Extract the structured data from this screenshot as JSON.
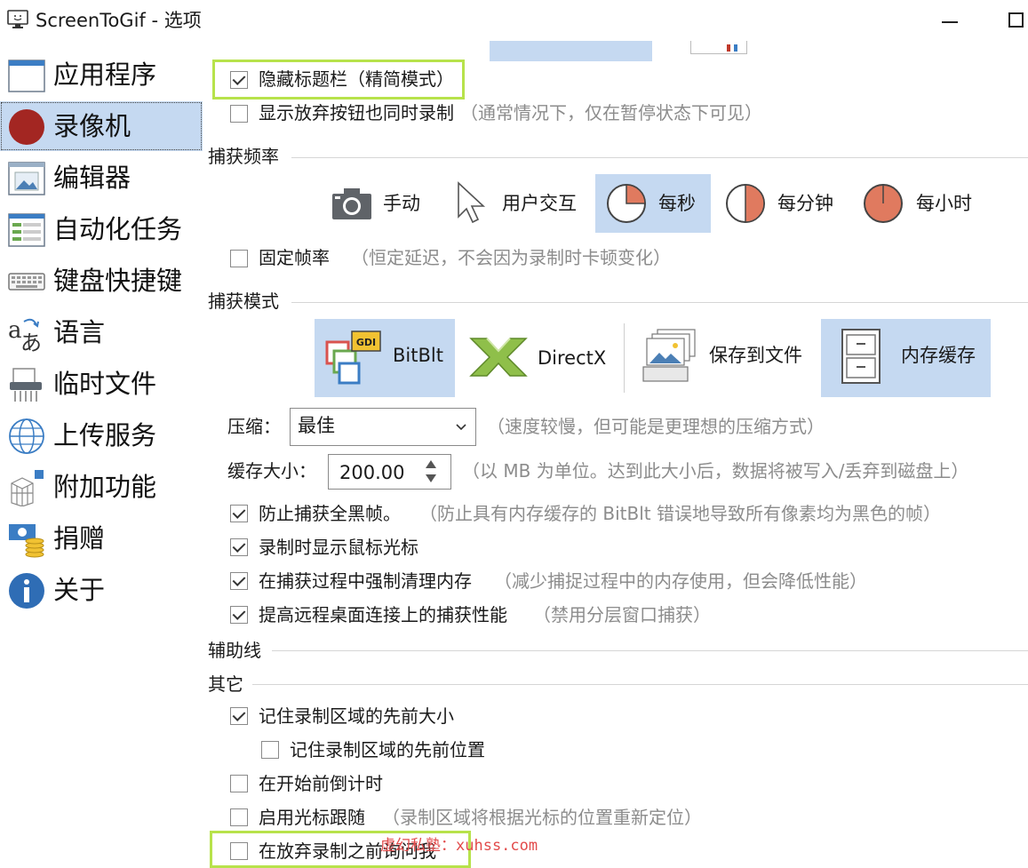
{
  "window": {
    "title": "ScreenToGif - 选项",
    "icon": "screen-monitor-icon"
  },
  "sidebar": {
    "selected_index": 1,
    "items": [
      {
        "label": "应用程序",
        "icon": "application-window-icon"
      },
      {
        "label": "录像机",
        "icon": "record-dot-icon"
      },
      {
        "label": "编辑器",
        "icon": "image-editor-icon"
      },
      {
        "label": "自动化任务",
        "icon": "automated-tasks-icon"
      },
      {
        "label": "键盘快捷键",
        "icon": "keyboard-icon"
      },
      {
        "label": "语言",
        "icon": "language-icon"
      },
      {
        "label": "临时文件",
        "icon": "temp-files-icon"
      },
      {
        "label": "上传服务",
        "icon": "globe-icon"
      },
      {
        "label": "附加功能",
        "icon": "extras-cube-icon"
      },
      {
        "label": "捐赠",
        "icon": "donate-coins-icon"
      },
      {
        "label": "关于",
        "icon": "info-icon"
      }
    ]
  },
  "recorder": {
    "top_options": [
      {
        "label": "隐藏标题栏（精简模式）",
        "checked": true,
        "note": ""
      },
      {
        "label": "显示放弃按钮也同时录制",
        "checked": false,
        "note": "（通常情况下，仅在暂停状态下可见）"
      }
    ],
    "frequency": {
      "title": "捕获频率",
      "modes": [
        {
          "label": "手动",
          "icon": "camera-icon",
          "selected": false
        },
        {
          "label": "用户交互",
          "icon": "cursor-pointer-icon",
          "selected": false
        },
        {
          "label": "每秒",
          "icon": "clock-quarter-icon",
          "selected": true
        },
        {
          "label": "每分钟",
          "icon": "clock-half-icon",
          "selected": false
        },
        {
          "label": "每小时",
          "icon": "clock-full-icon",
          "selected": false
        }
      ],
      "fixed_rate": {
        "label": "固定帧率",
        "checked": false,
        "note": "（恒定延迟，不会因为录制时卡顿变化）"
      }
    },
    "capture_mode": {
      "title": "捕获模式",
      "modes": [
        {
          "label": "BitBlt",
          "icon": "gdi-windows-icon",
          "selected": true
        },
        {
          "label": "DirectX",
          "icon": "directx-x-icon",
          "selected": false
        },
        {
          "label": "保存到文件",
          "icon": "save-images-icon",
          "selected": false
        },
        {
          "label": "内存缓存",
          "icon": "cabinet-icon",
          "selected": true
        }
      ],
      "compression_label": "压缩：",
      "compression_value": "最佳",
      "compression_note": "（速度较慢，但可能是更理想的压缩方式）",
      "cache_label": "缓存大小：",
      "cache_value": "200.00",
      "cache_note": "（以 MB 为单位。达到此大小后，数据将被写入/丢弃到磁盘上）",
      "options": [
        {
          "label": "防止捕获全黑帧。",
          "checked": true,
          "note": "（防止具有内存缓存的 BitBlt 错误地导致所有像素均为黑色的帧）"
        },
        {
          "label": "录制时显示鼠标光标",
          "checked": true,
          "note": ""
        },
        {
          "label": "在捕获过程中强制清理内存",
          "checked": true,
          "note": "（减少捕捉过程中的内存使用，但会降低性能）"
        },
        {
          "label": "提高远程桌面连接上的捕获性能",
          "checked": true,
          "note": "（禁用分层窗口捕获）"
        }
      ]
    },
    "guidelines": {
      "title": "辅助线"
    },
    "other": {
      "title": "其它",
      "options": [
        {
          "label": "记住录制区域的先前大小",
          "checked": true,
          "note": ""
        },
        {
          "label": "记住录制区域的先前位置",
          "checked": false,
          "note": ""
        },
        {
          "label": "在开始前倒计时",
          "checked": false,
          "note": ""
        },
        {
          "label": "启用光标跟随",
          "checked": false,
          "note": "（录制区域将根据光标的位置重新定位）"
        },
        {
          "label": "在放弃录制之前询问我",
          "checked": false,
          "note": ""
        }
      ]
    }
  },
  "watermark": "虚幻私塾：xuhss.com",
  "colors": {
    "selection": "#c5d9f1",
    "highlight_box": "#b7e24b",
    "note_text": "#8c8c8c",
    "record_red": "#a32622",
    "clock_orange": "#e07a5f"
  }
}
